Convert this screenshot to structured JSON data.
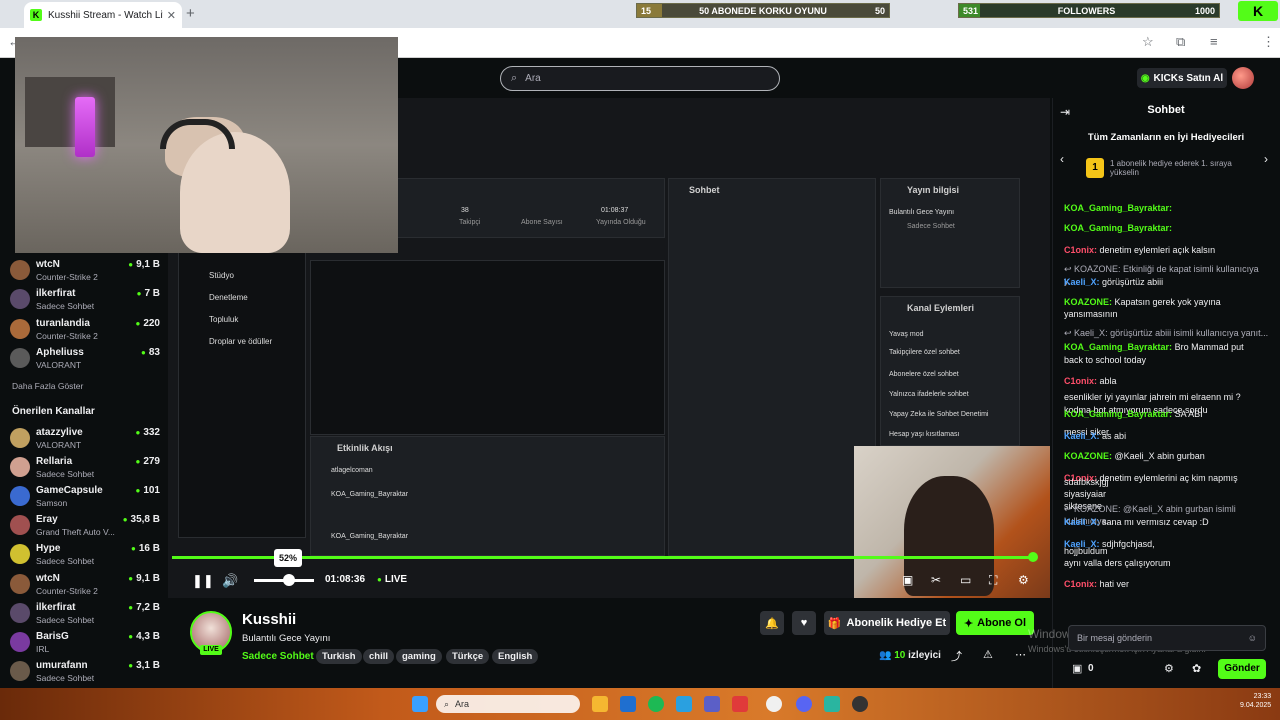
{
  "browser": {
    "tab_title": "Kusshii Stream - Watch Live on",
    "tab_close": "✕",
    "new_tab": "+"
  },
  "overlays": {
    "goal1": {
      "left": "15",
      "label": "50 ABONEDE KORKU OYUNU",
      "right": "50"
    },
    "goal2": {
      "left": "531",
      "label": "FOLLOWERS",
      "right": "1000"
    },
    "logo": "K"
  },
  "header": {
    "search_placeholder": "Ara",
    "kicks_label": "KICKs Satın Al"
  },
  "sidebar": {
    "following": [
      {
        "name": "wtcN",
        "category": "Counter-Strike 2",
        "viewers": "9,1 B",
        "color": "#8a5a3a"
      },
      {
        "name": "ilkerfirat",
        "category": "Sadece Sohbet",
        "viewers": "7 B",
        "color": "#5a4a6a"
      },
      {
        "name": "turanlandia",
        "category": "Counter-Strike 2",
        "viewers": "220",
        "color": "#aa6a3a"
      },
      {
        "name": "Apheliuss",
        "category": "VALORANT",
        "viewers": "83",
        "color": "#5a5a5a"
      }
    ],
    "show_more": "Daha Fazla Göster",
    "recommended_heading": "Önerilen Kanallar",
    "recommended": [
      {
        "name": "atazzylive",
        "category": "VALORANT",
        "viewers": "332",
        "color": "#c0a060"
      },
      {
        "name": "Rellaria",
        "category": "Sadece Sohbet",
        "viewers": "279",
        "color": "#d0a090"
      },
      {
        "name": "GameCapsule",
        "category": "Samson",
        "viewers": "101",
        "color": "#3a6ad0"
      },
      {
        "name": "Eray",
        "category": "Grand Theft Auto V...",
        "viewers": "35,8 B",
        "color": "#a05050"
      },
      {
        "name": "Hype",
        "category": "Sadece Sohbet",
        "viewers": "16 B",
        "color": "#d0c030"
      },
      {
        "name": "wtcN",
        "category": "Counter-Strike 2",
        "viewers": "9,1 B",
        "color": "#8a5a3a"
      },
      {
        "name": "ilkerfirat",
        "category": "Sadece Sohbet",
        "viewers": "7,2 B",
        "color": "#5a4a6a"
      },
      {
        "name": "BarisG",
        "category": "IRL",
        "viewers": "4,3 B",
        "color": "#7a3aa0"
      },
      {
        "name": "umurafann",
        "category": "Sadece Sohbet",
        "viewers": "3,1 B",
        "color": "#6a5a4a"
      }
    ]
  },
  "video_inner": {
    "chat_title": "Sohbet",
    "info_title": "Yayın bilgisi",
    "stream_title": "Bulantılı Gece Yayını",
    "category": "Sadece Sohbet",
    "stats": [
      "38",
      "Takipçi",
      "Abone Sayısı",
      "01:08:37",
      "Yayında Olduğu"
    ],
    "menu": [
      "Stüdyo",
      "Denetleme",
      "Topluluk",
      "Droplar ve ödüller"
    ],
    "channel_actions": "Kanal Eylemleri",
    "actions": [
      "Yavaş mod",
      "Takipçilere özel sohbet",
      "Abonelere özel sohbet",
      "Yalnızca ifadelerle sohbet",
      "Yapay Zeka ile Sohbet Denetimi",
      "Hesap yaşı kısıtlaması"
    ],
    "activity_title": "Etkinlik Akışı",
    "activity": [
      "atlagelcoman",
      "KOA_Gaming_Bayraktar",
      "KOA_Gaming_Bayraktar"
    ]
  },
  "player": {
    "volume_tooltip": "52%",
    "volume_level": 0.52,
    "time": "01:08:36",
    "live_label": "LIVE"
  },
  "streamer": {
    "name": "Kusshii",
    "live_badge": "LIVE",
    "title": "Bulantılı Gece Yayını",
    "category": "Sadece Sohbet",
    "tags": [
      "Turkish",
      "chill",
      "gaming",
      "Türkçe",
      "English"
    ],
    "gift_sub_label": "Abonelik Hediye Et",
    "subscribe_label": "Abone Ol",
    "viewers_count": "10",
    "viewers_label": "izleyici"
  },
  "chat": {
    "title": "Sohbet",
    "gifters_title": "Tüm Zamanların en İyi Hediyecileri",
    "gifters_rank": "1",
    "gifters_text": "1 abonelik hediye ederek 1. sıraya yükselin",
    "messages": [
      {
        "user": "KOA_Gaming_Bayraktar:",
        "text": "",
        "color": "#53fc18"
      },
      {
        "user": "KOA_Gaming_Bayraktar:",
        "text": "",
        "color": "#53fc18"
      },
      {
        "user": "C1onix:",
        "text": "denetim eylemleri açık kalsın",
        "color": "#ff4f6a"
      },
      {
        "user": "",
        "text": "↩ KOAZONE: Etkinliği de kapat isimli kullanıcıya y...",
        "color": "#adadb8"
      },
      {
        "user": "Kaeli_X:",
        "text": "görüşürtüz abiii",
        "color": "#4fa3ff"
      },
      {
        "user": "KOAZONE:",
        "text": "Kapatsın gerek yok yayına yansımasının",
        "color": "#53fc18"
      },
      {
        "user": "",
        "text": "↩ Kaeli_X: görüşürtüz abiii isimli kullanıcıya yanıt...",
        "color": "#adadb8"
      },
      {
        "user": "KOA_Gaming_Bayraktar:",
        "text": "Bro Mammad put",
        "color": "#53fc18"
      },
      {
        "user": "",
        "text": "back to school today",
        "color": "#efeff1"
      },
      {
        "user": "C1onix:",
        "text": "abla",
        "color": "#ff4f6a"
      },
      {
        "user": "",
        "text": "esenlikler iyi yayınlar jahrein mi elraenn mi ?",
        "color": "#efeff1"
      },
      {
        "user": "",
        "text": "kodma bot atmıyorum sadece sordu",
        "color": "#efeff1"
      },
      {
        "user": "KOA_Gaming_Bayraktar:",
        "text": "SA ABİ",
        "color": "#53fc18"
      },
      {
        "user": "",
        "text": "messi siker",
        "color": "#efeff1"
      },
      {
        "user": "Kaeli_X:",
        "text": "as abi",
        "color": "#4fa3ff"
      },
      {
        "user": "KOAZONE:",
        "text": "@Kaeli_X abin gurban",
        "color": "#53fc18"
      },
      {
        "user": "C1onix:",
        "text": "denetim eylemlerini aç kim napmış",
        "color": "#ff4f6a"
      },
      {
        "user": "",
        "text": "sdafbkskjgj",
        "color": "#efeff1"
      },
      {
        "user": "",
        "text": "siyasiyaiar",
        "color": "#efeff1"
      },
      {
        "user": "",
        "text": "siktesene",
        "color": "#efeff1"
      },
      {
        "user": "",
        "text": "↩ KOAZONE: @Kaeli_X abin gurban isimli kullanıcıya...",
        "color": "#adadb8"
      },
      {
        "user": "Kaeli_X:",
        "text": "sana mı vermısız cevap :D",
        "color": "#4fa3ff"
      },
      {
        "user": "Kaeli_X:",
        "text": "sdjhfgchjasd,",
        "color": "#4fa3ff"
      },
      {
        "user": "",
        "text": "hojjbuldum",
        "color": "#efeff1"
      },
      {
        "user": "",
        "text": "aynı valla ders çalışıyorum",
        "color": "#efeff1"
      },
      {
        "user": "C1onix:",
        "text": "hati ver",
        "color": "#ff4f6a"
      }
    ],
    "input_placeholder": "Bir mesaj gönderin",
    "points": "0",
    "send_label": "Gönder",
    "watermark_title": "Windows'u Etkinleştir",
    "watermark_text": "Windows'u etkinleştirmek için Ayarlar'a gidin."
  },
  "taskbar": {
    "search_placeholder": "Ara",
    "time": "23:33",
    "date": "9.04.2025"
  }
}
